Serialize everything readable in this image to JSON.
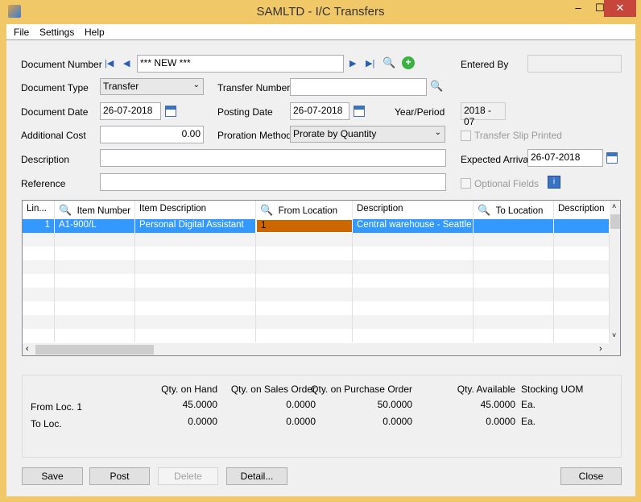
{
  "window": {
    "title": "SAMLTD - I/C Transfers",
    "minimize": "–",
    "maximize": "☐",
    "close": "✕"
  },
  "menu": [
    "File",
    "Settings",
    "Help"
  ],
  "form": {
    "document_number_label": "Document Number",
    "document_number": "*** NEW ***",
    "entered_by_label": "Entered By",
    "entered_by": "",
    "document_type_label": "Document Type",
    "document_type": "Transfer",
    "transfer_number_label": "Transfer Number",
    "transfer_number": "",
    "document_date_label": "Document Date",
    "document_date": "26-07-2018",
    "posting_date_label": "Posting Date",
    "posting_date": "26-07-2018",
    "year_period_label": "Year/Period",
    "year_period": "2018 - 07",
    "additional_cost_label": "Additional Cost",
    "additional_cost": "0.00",
    "proration_method_label": "Proration Method",
    "proration_method": "Prorate by Quantity",
    "transfer_slip_printed_label": "Transfer Slip Printed",
    "description_label": "Description",
    "description": "",
    "expected_arrival_label": "Expected Arrival",
    "expected_arrival": "26-07-2018",
    "reference_label": "Reference",
    "reference": "",
    "optional_fields_label": "Optional Fields"
  },
  "grid": {
    "columns": [
      "Lin...",
      "Item Number",
      "Item Description",
      "From Location",
      "Description",
      "To Location",
      "Description"
    ],
    "rows": [
      {
        "line": "1",
        "item_number": "A1-900/L",
        "item_description": "Personal  Digital Assistant",
        "from_location": "1",
        "from_description": "Central warehouse - Seattle",
        "to_location": "",
        "to_description": ""
      }
    ]
  },
  "qty": {
    "headers": [
      "Qty. on Hand",
      "Qty. on Sales Order",
      "Qty. on Purchase Order",
      "Qty. Available",
      "Stocking UOM"
    ],
    "rows": [
      {
        "label": "From Loc. 1",
        "values": [
          "45.0000",
          "0.0000",
          "50.0000",
          "45.0000"
        ],
        "uom": "Ea."
      },
      {
        "label": "To Loc.",
        "values": [
          "0.0000",
          "0.0000",
          "0.0000",
          "0.0000"
        ],
        "uom": "Ea."
      }
    ]
  },
  "buttons": {
    "save": "Save",
    "post": "Post",
    "delete": "Delete",
    "detail": "Detail...",
    "close": "Close"
  },
  "colors": {
    "selected_row": "#3399ff",
    "from_location_cell": "#cc6600",
    "frame": "#f0c868"
  }
}
